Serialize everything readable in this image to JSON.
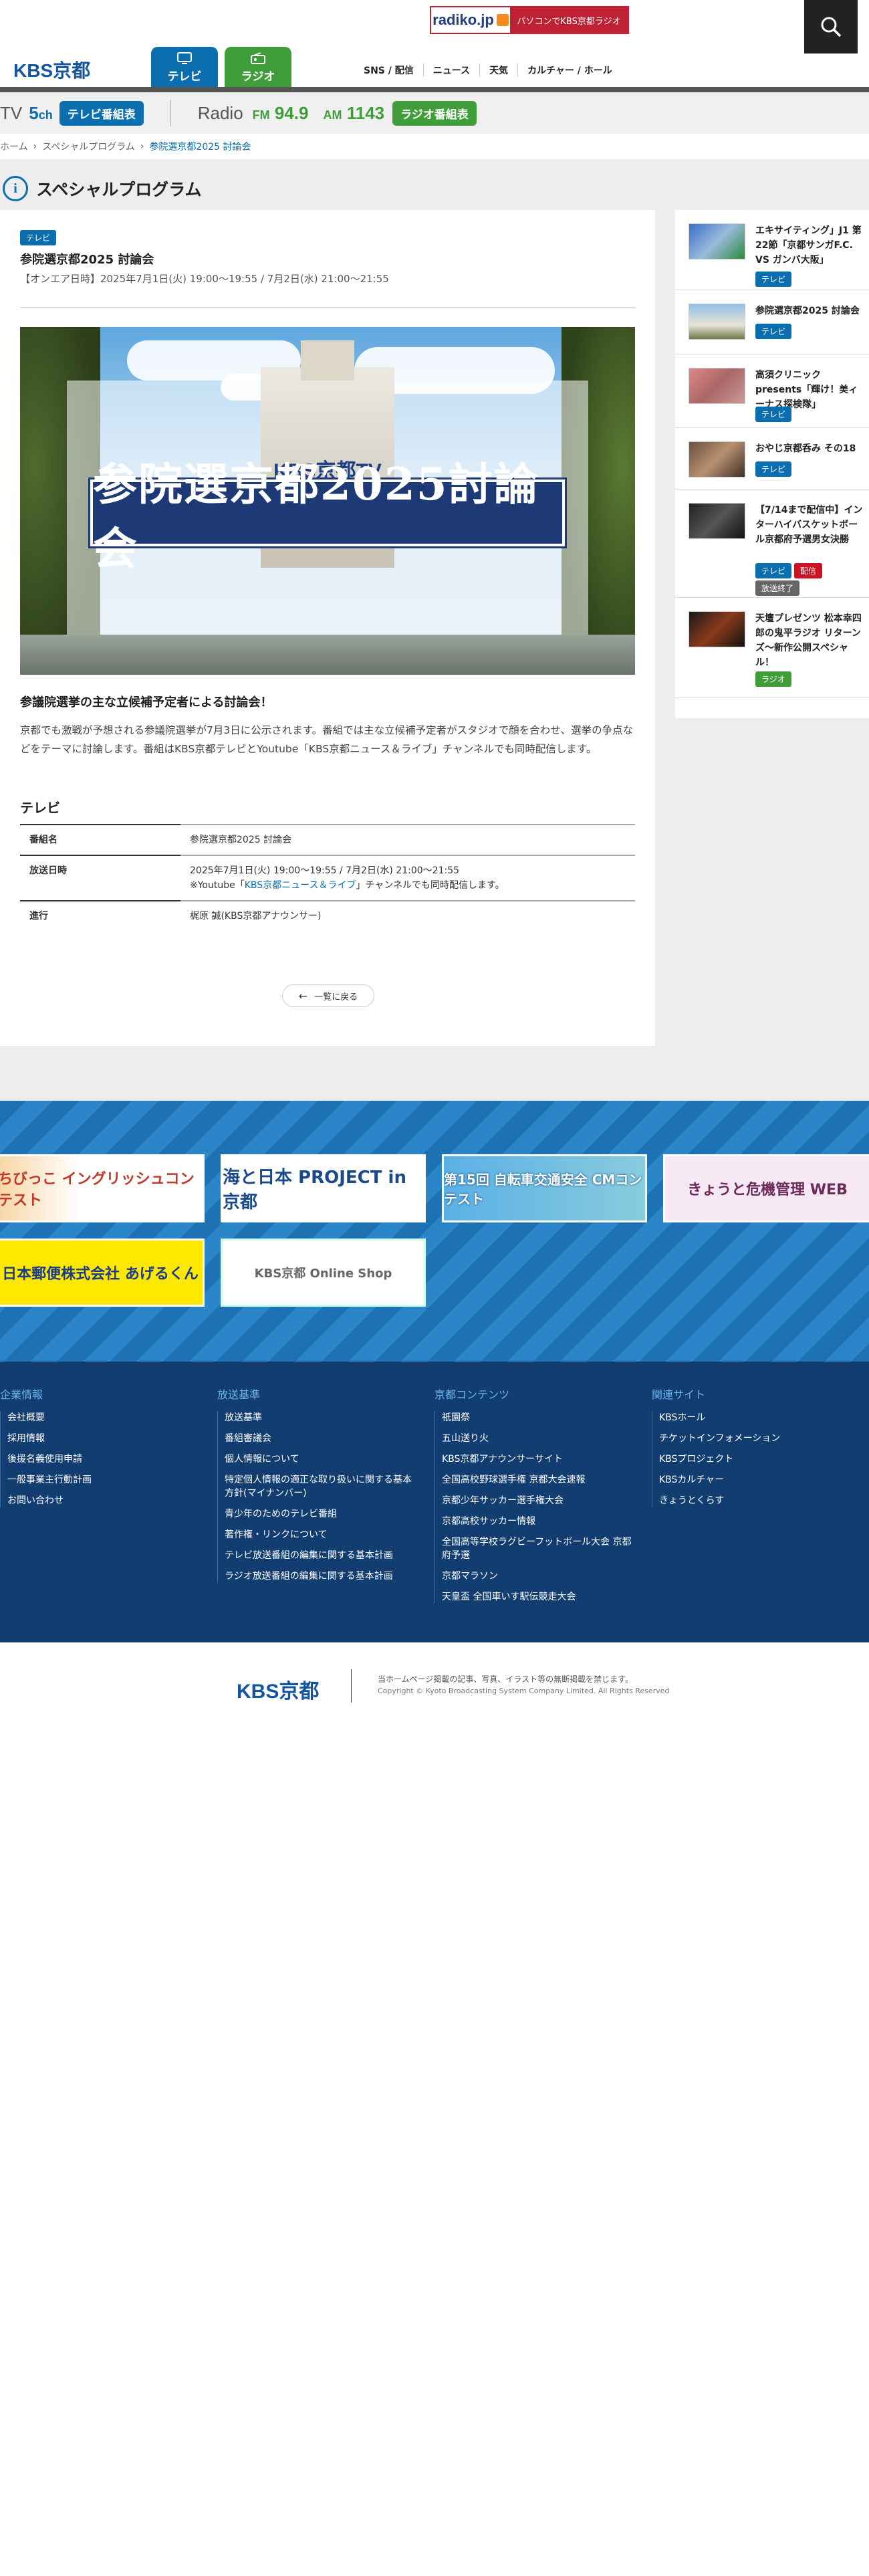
{
  "header": {
    "brand": "KBS京都",
    "radiko_logo": "radiko.jp",
    "radiko_text": "パソコンでKBS京都ラジオ",
    "tabs": [
      {
        "label": "テレビ"
      },
      {
        "label": "ラジオ"
      }
    ],
    "nav": [
      "SNS / 配信",
      "ニュース",
      "天気",
      "カルチャー / ホール"
    ],
    "colors": {
      "tv": "#0a6eaf",
      "radio": "#3f9e3a",
      "radiko": "#be2034"
    }
  },
  "channels": {
    "tv_label": "TV",
    "tv_channel": "5",
    "tv_channel_unit": "ch",
    "tv_button": "テレビ番組表",
    "radio_label": "Radio",
    "fm_label": "FM",
    "fm_value": "94.9",
    "am_label": "AM",
    "am_value": "1143",
    "radio_button": "ラジオ番組表"
  },
  "breadcrumb": [
    "ホーム",
    "スペシャルプログラム",
    "参院選京都2025 討論会"
  ],
  "page": {
    "title": "スペシャルプログラム"
  },
  "article": {
    "tag": "テレビ",
    "title": "参院選京都2025 討論会",
    "onair": "【オンエア日時】2025年7月1日(火) 19:00〜19:55 / 7月2日(水) 21:00〜21:55",
    "hero_logo": "KBS京都TV",
    "hero_title": "参院選京都2025討論会",
    "lead": "参議院選挙の主な立候補予定者による討論会！",
    "description": "京都でも激戦が予想される参議院選挙が7月3日に公示されます。番組では主な立候補予定者がスタジオで顔を合わせ、選挙の争点などをテーマに討論します。番組はKBS京都テレビとYoutube「KBS京都ニュース＆ライブ」チャンネルでも同時配信します。",
    "section_heading": "テレビ",
    "table": {
      "program_label": "番組名",
      "program_value": "参院選京都2025 討論会",
      "broadcast_label": "放送日時",
      "broadcast_value": "2025年7月1日(火) 19:00〜19:55 / 7月2日(水) 21:00〜21:55",
      "youtube_prefix": "※Youtube「",
      "youtube_link": "KBS京都ニュース＆ライブ",
      "youtube_suffix": "」チャンネルでも同時配信します。",
      "host_label": "進行",
      "host_value": "梶原 誠(KBS京都アナウンサー)"
    },
    "back_button": "一覧に戻る"
  },
  "sidebar": {
    "items": [
      {
        "title": "エキサイティング」J1 第22節「京都サンガF.C. VS ガンバ大阪」",
        "tags": [
          "テレビ"
        ]
      },
      {
        "title": "参院選京都2025 討論会",
        "tags": [
          "テレビ"
        ]
      },
      {
        "title": "高須クリニック presents「輝け！美ィーナス探検隊」",
        "tags": [
          "テレビ"
        ]
      },
      {
        "title": "おやじ京都呑み その18",
        "tags": [
          "テレビ"
        ]
      },
      {
        "title": "【7/14まで配信中】インターハイバスケットボール京都府予選男女決勝",
        "tags": [
          "テレビ",
          "配信",
          "放送終了"
        ]
      },
      {
        "title": "天壇プレゼンツ 松本幸四郎の鬼平ラジオ リターンズ〜新作公開スペシャル！",
        "tags": [
          "ラジオ"
        ]
      }
    ]
  },
  "banners": [
    {
      "label": "ちびっこ イングリッシュコンテスト"
    },
    {
      "label": "海と日本 PROJECT in 京都"
    },
    {
      "label": "第15回 自転車交通安全 CMコンテスト"
    },
    {
      "label": "きょうと危機管理 WEB"
    },
    {
      "label": "日本郵便株式会社 あげるくん"
    },
    {
      "label": "KBS京都 Online Shop"
    }
  ],
  "footer": {
    "columns": [
      {
        "heading": "企業情報",
        "items": [
          "会社概要",
          "採用情報",
          "後援名義使用申請",
          "一般事業主行動計画",
          "お問い合わせ"
        ]
      },
      {
        "heading": "放送基準",
        "items": [
          "放送基準",
          "番組審議会",
          "個人情報について",
          "特定個人情報の適正な取り扱いに関する基本方針(マイナンバー)",
          "青少年のためのテレビ番組",
          "著作権・リンクについて",
          "テレビ放送番組の編集に関する基本計画",
          "ラジオ放送番組の編集に関する基本計画"
        ]
      },
      {
        "heading": "京都コンテンツ",
        "items": [
          "祇園祭",
          "五山送り火",
          "KBS京都アナウンサーサイト",
          "全国高校野球選手権 京都大会速報",
          "京都少年サッカー選手権大会",
          "京都高校サッカー情報",
          "全国高等学校ラグビーフットボール大会 京都府予選",
          "京都マラソン",
          "天皇盃 全国車いす駅伝競走大会"
        ]
      },
      {
        "heading": "関連サイト",
        "items": [
          "KBSホール",
          "チケットインフォメーション",
          "KBSプロジェクト",
          "KBSカルチャー",
          "きょうとくらす"
        ]
      }
    ],
    "brand": "KBS京都",
    "note": "当ホームページ掲載の記事、写真、イラスト等の無断掲載を禁じます。",
    "copyright": "Copyright © Kyoto Broadcasting System Company Limited. All Rights Reserved"
  }
}
